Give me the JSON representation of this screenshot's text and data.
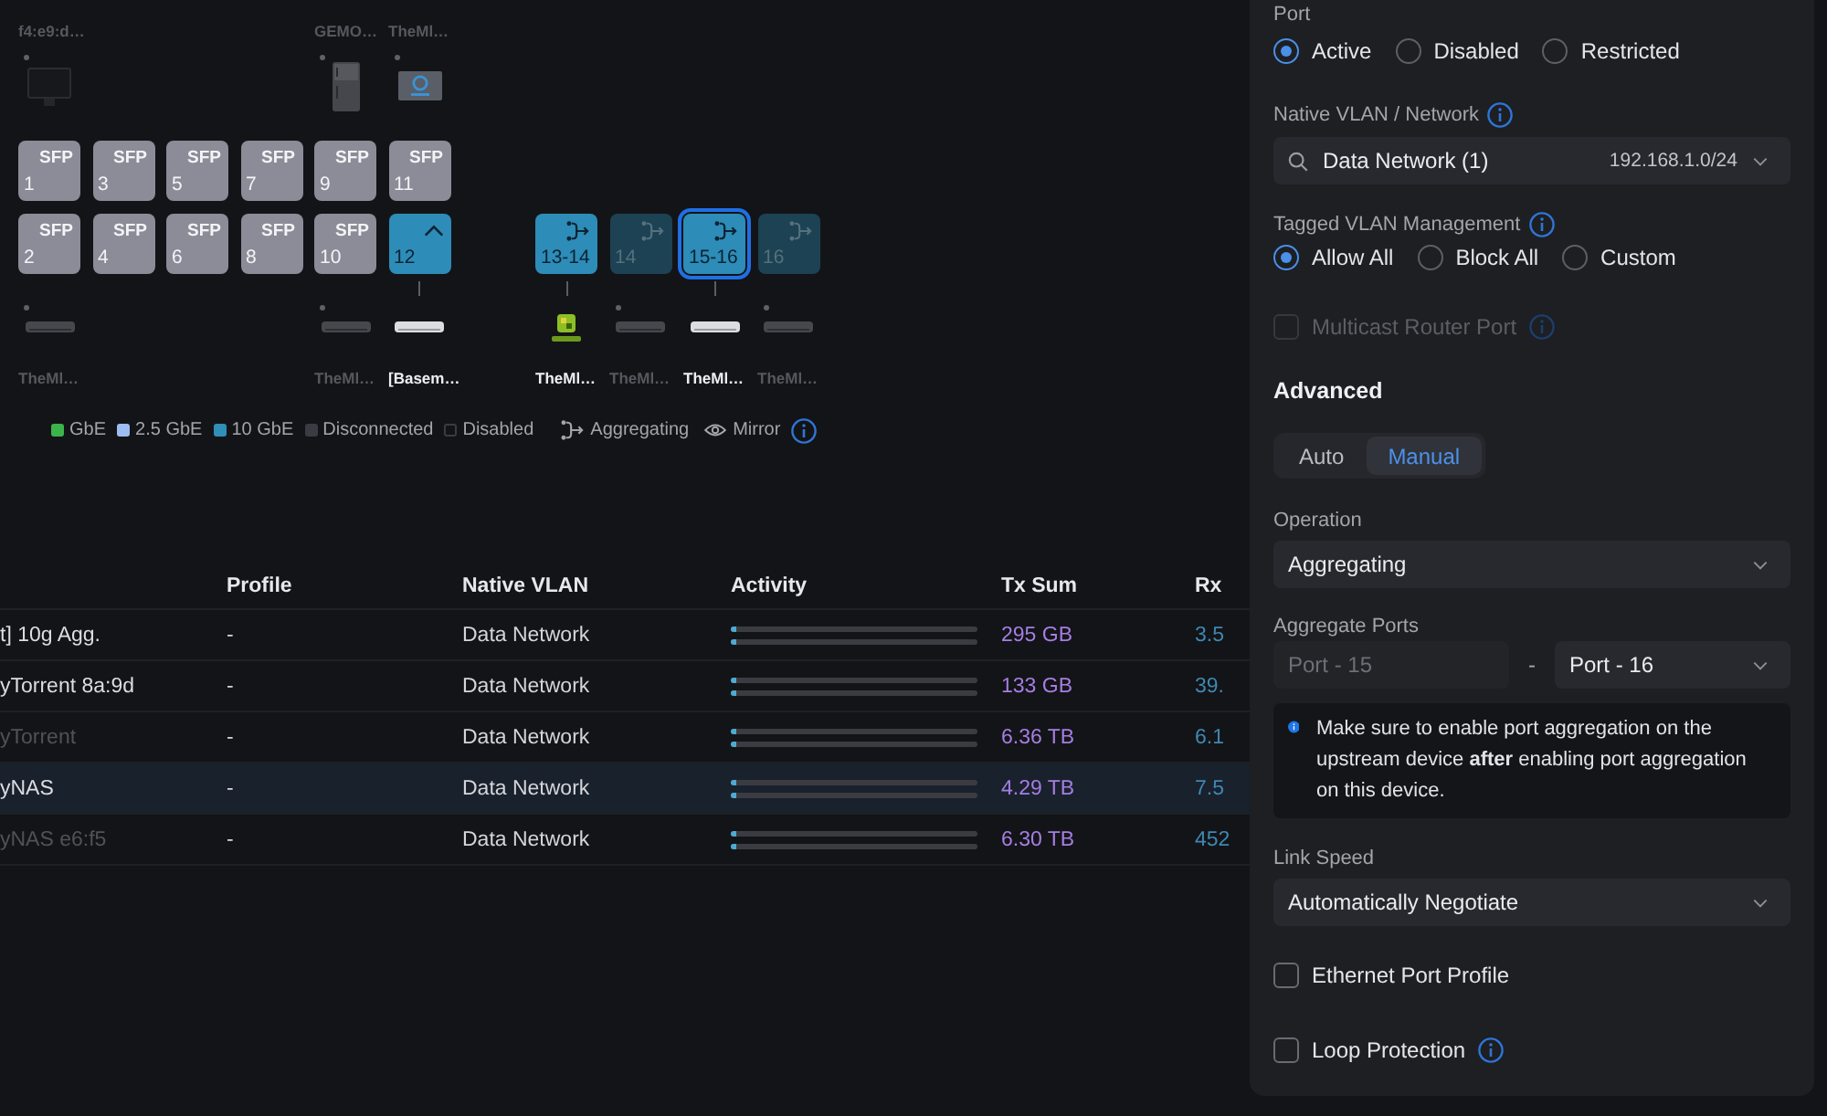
{
  "port_map": {
    "groups": [
      {
        "columns": [
          {
            "top_device": {
              "label": "f4:e9:d…",
              "kind": "monitor",
              "connected": false
            },
            "ports": [
              {
                "number": "1",
                "kind": "sfp",
                "tag": "SFP",
                "color": "#8b8c97",
                "selected": false
              },
              {
                "number": "2",
                "kind": "sfp",
                "tag": "SFP",
                "color": "#8b8c97",
                "selected": false
              }
            ],
            "bottom_device": {
              "label": "TheMl…",
              "kind": "switch",
              "connected": false
            }
          },
          {
            "ports": [
              {
                "number": "3",
                "kind": "sfp",
                "tag": "SFP",
                "color": "#8b8c97",
                "selected": false
              },
              {
                "number": "4",
                "kind": "sfp",
                "tag": "SFP",
                "color": "#8b8c97",
                "selected": false
              }
            ]
          },
          {
            "ports": [
              {
                "number": "5",
                "kind": "sfp",
                "tag": "SFP",
                "color": "#8b8c97",
                "selected": false
              },
              {
                "number": "6",
                "kind": "sfp",
                "tag": "SFP",
                "color": "#8b8c97",
                "selected": false
              }
            ]
          },
          {
            "ports": [
              {
                "number": "7",
                "kind": "sfp",
                "tag": "SFP",
                "color": "#8b8c97",
                "selected": false
              },
              {
                "number": "8",
                "kind": "sfp",
                "tag": "SFP",
                "color": "#8b8c97",
                "selected": false
              }
            ]
          },
          {
            "top_device": {
              "label": "GEMO…",
              "kind": "fridge",
              "connected": false
            },
            "ports": [
              {
                "number": "9",
                "kind": "sfp",
                "tag": "SFP",
                "color": "#8b8c97",
                "selected": false
              },
              {
                "number": "10",
                "kind": "sfp",
                "tag": "SFP",
                "color": "#8b8c97",
                "selected": false
              }
            ],
            "bottom_device": {
              "label": "TheMl…",
              "kind": "switch",
              "connected": false
            }
          },
          {
            "top_device": {
              "label": "TheMl…",
              "kind": "nas",
              "connected": false
            },
            "ports": [
              {
                "number": "11",
                "kind": "sfp",
                "tag": "SFP",
                "color": "#8b8c97",
                "selected": false
              },
              {
                "number": "12",
                "kind": "uplink",
                "color": "#2d8cb8",
                "selected": false
              }
            ],
            "bottom_device": {
              "label": "[Basem…",
              "kind": "switch",
              "connected": true
            }
          }
        ]
      },
      {
        "columns": [
          {
            "ports": [
              {
                "number": "13-14",
                "kind": "aggregate",
                "color": "#2d8cb8",
                "selected": false
              }
            ],
            "bottom_device": {
              "label": "TheMl…",
              "kind": "vm",
              "connected": true
            }
          },
          {
            "ports": [
              {
                "number": "14",
                "kind": "aggregate",
                "color": "#1c4253",
                "selected": false
              }
            ],
            "bottom_device": {
              "label": "TheMl…",
              "kind": "switch",
              "connected": false
            }
          },
          {
            "ports": [
              {
                "number": "15-16",
                "kind": "aggregate",
                "color": "#2d8cb8",
                "selected": true
              }
            ],
            "bottom_device": {
              "label": "TheMl…",
              "kind": "switch",
              "connected": true
            }
          },
          {
            "ports": [
              {
                "number": "16",
                "kind": "aggregate",
                "color": "#1c4253",
                "selected": false
              }
            ],
            "bottom_device": {
              "label": "TheMl…",
              "kind": "switch",
              "connected": false
            }
          }
        ]
      }
    ],
    "legend": [
      {
        "label": "GbE",
        "kind": "swatch",
        "color": "#3cb44b"
      },
      {
        "label": "2.5 GbE",
        "kind": "swatch",
        "color": "#9dbdf2"
      },
      {
        "label": "10 GbE",
        "kind": "swatch",
        "color": "#2f8fb6"
      },
      {
        "label": "Disconnected",
        "kind": "swatch",
        "color": "#3a3c43"
      },
      {
        "label": "Disabled",
        "kind": "outline",
        "color": "#3a3c43"
      },
      {
        "label": "Aggregating",
        "kind": "aggregate"
      },
      {
        "label": "Mirror",
        "kind": "eye"
      }
    ]
  },
  "table": {
    "headers": [
      "Profile",
      "Native VLAN",
      "Activity",
      "Tx Sum",
      "Rx"
    ],
    "rows": [
      {
        "name": "t] 10g Agg.",
        "offline": false,
        "selected": false,
        "profile": "-",
        "native_vlan": "Data Network",
        "activity": [
          {
            "level": 0.02
          },
          {
            "level": 0.02
          }
        ],
        "tx_sum": "295 GB",
        "rx": "3.5"
      },
      {
        "name": "yTorrent 8a:9d",
        "offline": false,
        "selected": false,
        "profile": "-",
        "native_vlan": "Data Network",
        "activity": [
          {
            "level": 0.02
          },
          {
            "level": 0.02
          }
        ],
        "tx_sum": "133 GB",
        "rx": "39."
      },
      {
        "name": "yTorrent",
        "offline": true,
        "selected": false,
        "profile": "-",
        "native_vlan": "Data Network",
        "activity": [
          {
            "level": 0.02
          },
          {
            "level": 0.02
          }
        ],
        "tx_sum": "6.36 TB",
        "rx": "6.1"
      },
      {
        "name": "yNAS",
        "offline": false,
        "selected": true,
        "profile": "-",
        "native_vlan": "Data Network",
        "activity": [
          {
            "level": 0.02
          },
          {
            "level": 0.02
          }
        ],
        "tx_sum": "4.29 TB",
        "rx": "7.5"
      },
      {
        "name": "yNAS e6:f5",
        "offline": true,
        "selected": false,
        "profile": "-",
        "native_vlan": "Data Network",
        "activity": [
          {
            "level": 0.02
          },
          {
            "level": 0.02
          }
        ],
        "tx_sum": "6.30 TB",
        "rx": "452"
      }
    ]
  },
  "port_settings": {
    "port": {
      "label": "Port",
      "options": [
        {
          "label": "Active",
          "selected": true
        },
        {
          "label": "Disabled",
          "selected": false
        },
        {
          "label": "Restricted",
          "selected": false
        }
      ]
    },
    "native_vlan": {
      "label": "Native VLAN / Network",
      "value": "Data Network (1)",
      "subnet": "192.168.1.0/24"
    },
    "tagged_vlan": {
      "label": "Tagged VLAN Management",
      "options": [
        {
          "label": "Allow All",
          "selected": true
        },
        {
          "label": "Block All",
          "selected": false
        },
        {
          "label": "Custom",
          "selected": false
        }
      ]
    },
    "multicast_router_port": {
      "label": "Multicast Router Port",
      "checked": false,
      "disabled": true
    },
    "advanced": {
      "title": "Advanced",
      "modes": [
        {
          "label": "Auto",
          "selected": false
        },
        {
          "label": "Manual",
          "selected": true
        }
      ]
    },
    "operation": {
      "label": "Operation",
      "value": "Aggregating"
    },
    "aggregate_ports": {
      "label": "Aggregate Ports",
      "from": {
        "value": "Port - 15",
        "disabled": true
      },
      "separator": "-",
      "to": {
        "value": "Port - 16",
        "disabled": false
      }
    },
    "notice": "Make sure to enable port aggregation on the upstream device **after** enabling port aggregation on this device.",
    "link_speed": {
      "label": "Link Speed",
      "value": "Automatically Negotiate"
    },
    "ethernet_port_profile": {
      "label": "Ethernet Port Profile",
      "checked": false,
      "disabled": false
    },
    "loop_protection": {
      "label": "Loop Protection",
      "checked": false,
      "disabled": false
    }
  }
}
